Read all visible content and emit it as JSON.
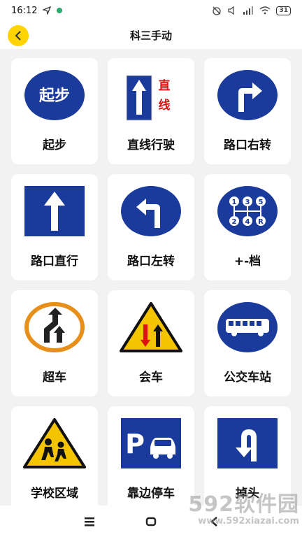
{
  "status": {
    "time": "16:12",
    "battery": "31"
  },
  "header": {
    "title": "科三手动",
    "back_icon": "chevron-left-icon"
  },
  "colors": {
    "accent": "#ffd400",
    "sign_blue": "#1a3a9c",
    "warning_yellow": "#f4c400",
    "warning_red": "#d11",
    "orange_ring": "#e78f1a"
  },
  "items": [
    {
      "label": "起步",
      "sign_text": "起步",
      "icon": "start-sign-icon"
    },
    {
      "label": "直线行驶",
      "sign_text": "直线",
      "icon": "straight-sign-icon"
    },
    {
      "label": "路口右转",
      "icon": "turn-right-sign-icon"
    },
    {
      "label": "路口直行",
      "icon": "go-straight-sign-icon"
    },
    {
      "label": "路口左转",
      "icon": "turn-left-sign-icon"
    },
    {
      "label": "+-档",
      "gear_labels": [
        "1",
        "3",
        "5",
        "2",
        "4",
        "R"
      ],
      "icon": "gear-shift-sign-icon"
    },
    {
      "label": "超车",
      "icon": "overtake-sign-icon"
    },
    {
      "label": "会车",
      "icon": "meeting-sign-icon"
    },
    {
      "label": "公交车站",
      "icon": "bus-stop-sign-icon"
    },
    {
      "label": "学校区域",
      "icon": "school-zone-sign-icon"
    },
    {
      "label": "靠边停车",
      "sign_text": "P",
      "icon": "parking-sign-icon"
    },
    {
      "label": "掉头",
      "icon": "u-turn-sign-icon"
    }
  ],
  "navigation": {
    "menu_icon": "menu-icon",
    "home_icon": "home-icon",
    "back_icon": "back-nav-icon"
  },
  "watermark": {
    "brand": "592软件园",
    "url": "www.592xiazai.com"
  }
}
